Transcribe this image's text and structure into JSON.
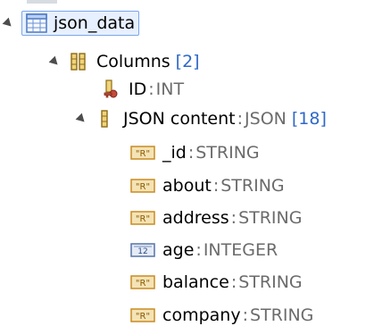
{
  "tree": {
    "root": {
      "label": "json_data"
    },
    "columns": {
      "label": "Columns",
      "count": "[2]"
    },
    "id_column": {
      "label": "ID",
      "sep": ":",
      "type": "INT"
    },
    "json_column": {
      "label": "JSON content",
      "sep": ":",
      "type": "JSON",
      "count": "[18]"
    },
    "fields": [
      {
        "label": "_id",
        "sep": ":",
        "type": "STRING",
        "icon": "string-type-icon"
      },
      {
        "label": "about",
        "sep": ":",
        "type": "STRING",
        "icon": "string-type-icon"
      },
      {
        "label": "address",
        "sep": ":",
        "type": "STRING",
        "icon": "string-type-icon"
      },
      {
        "label": "age",
        "sep": ":",
        "type": "INTEGER",
        "icon": "integer-type-icon"
      },
      {
        "label": "balance",
        "sep": ":",
        "type": "STRING",
        "icon": "string-type-icon"
      },
      {
        "label": "company",
        "sep": ":",
        "type": "STRING",
        "icon": "string-type-icon"
      }
    ]
  },
  "colors": {
    "selection_border": "#7aa7ea",
    "selection_fill": "#e7f0ff",
    "type_text": "#6b6b6b",
    "count_text": "#2f68c9",
    "table_icon": "#4a78c2",
    "key_icon": "#b84b3f",
    "column_icon": "#c8a13a",
    "string_icon": "#d08a24",
    "integer_icon": "#5673a8"
  }
}
